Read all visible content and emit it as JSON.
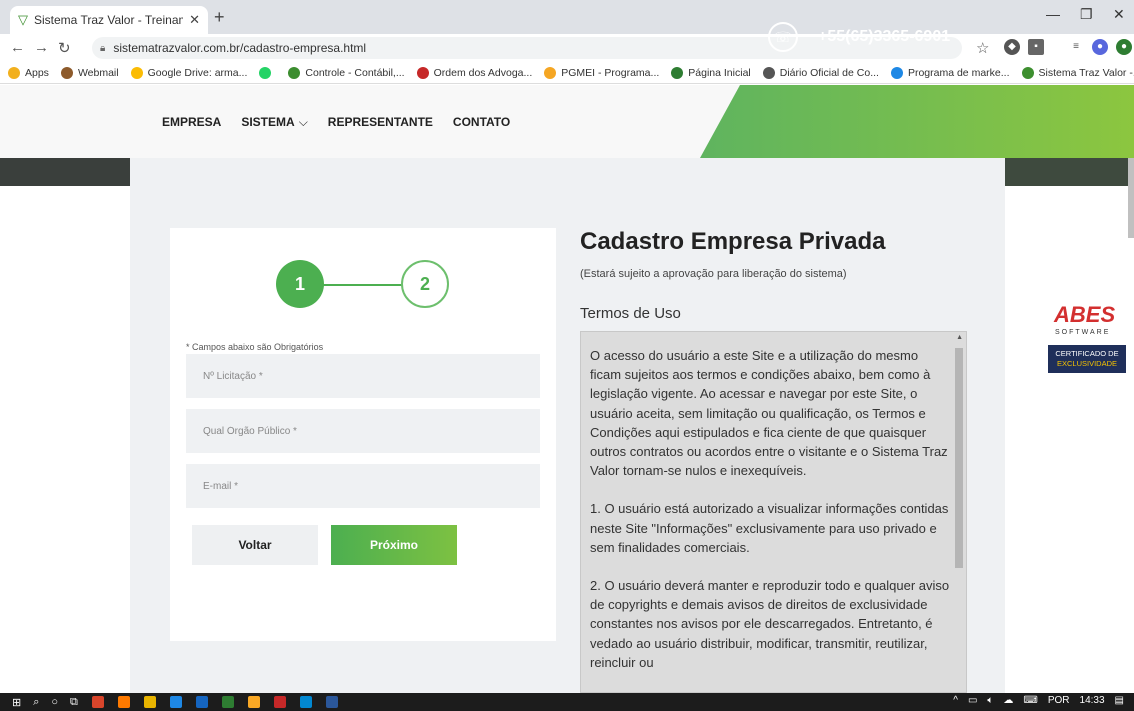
{
  "browser": {
    "tab_title": "Sistema Traz Valor - Treinamento",
    "url": "sistematrazvalor.com.br/cadastro-empresa.html",
    "bookmarks": [
      {
        "label": "Apps",
        "color": "#f2b01e"
      },
      {
        "label": "Webmail",
        "color": "#8d5a2b"
      },
      {
        "label": "Google Drive: arma...",
        "color": "#fbbc04"
      },
      {
        "label": "",
        "color": "#25d366"
      },
      {
        "label": "Controle - Contábil,...",
        "color": "#3c8d2f"
      },
      {
        "label": "Ordem dos Advoga...",
        "color": "#c62828"
      },
      {
        "label": "PGMEI - Programa...",
        "color": "#f5a623"
      },
      {
        "label": "Página Inicial",
        "color": "#2e7d32"
      },
      {
        "label": "Diário Oficial de Co...",
        "color": "#555555"
      },
      {
        "label": "Programa de marke...",
        "color": "#1e88e5"
      },
      {
        "label": "Sistema Traz Valor -...",
        "color": "#3d8f2f"
      }
    ]
  },
  "header": {
    "menu": [
      "EMPRESA",
      "SISTEMA",
      "REPRESENTANTE",
      "CONTATO"
    ],
    "phone": "+55(65)3365-6901"
  },
  "form": {
    "steps": [
      "1",
      "2"
    ],
    "required_note": "* Campos abaixo são Obrigatórios",
    "fields": {
      "licitacao_placeholder": "Nº Licitação *",
      "orgao_placeholder": "Qual Órgão Público *",
      "email_placeholder": "E-mail *"
    },
    "back_label": "Voltar",
    "next_label": "Próximo"
  },
  "main": {
    "title": "Cadastro Empresa Privada",
    "subtitle": "(Estará sujeito a aprovação para liberação do sistema)",
    "terms_heading": "Termos de Uso",
    "terms_paragraphs": [
      "O acesso do usuário a este Site e a utilização do mesmo ficam sujeitos aos termos e condições abaixo, bem como à legislação vigente. Ao acessar e navegar por este Site, o usuário aceita, sem limitação ou qualificação, os Termos e Condições aqui estipulados e fica ciente de que quaisquer outros contratos ou acordos entre o visitante e o Sistema Traz Valor tornam-se nulos e inexequíveis.",
      "1. O usuário está autorizado a visualizar informações contidas neste Site \"Informações\" exclusivamente para uso privado e sem finalidades comerciais.",
      "2. O usuário deverá manter e reproduzir todo e qualquer aviso de copyrights e demais avisos de direitos de exclusividade constantes nos avisos por ele descarregados. Entretanto, é vedado ao usuário distribuir, modificar, transmitir, reutilizar, reincluir ou"
    ]
  },
  "badge": {
    "logo": "ABES",
    "software": "SOFTWARE",
    "cert_line1": "CERTIFICADO DE",
    "cert_line2": "EXCLUSIVIDADE"
  },
  "taskbar": {
    "lang": "POR",
    "time": "14:33"
  }
}
